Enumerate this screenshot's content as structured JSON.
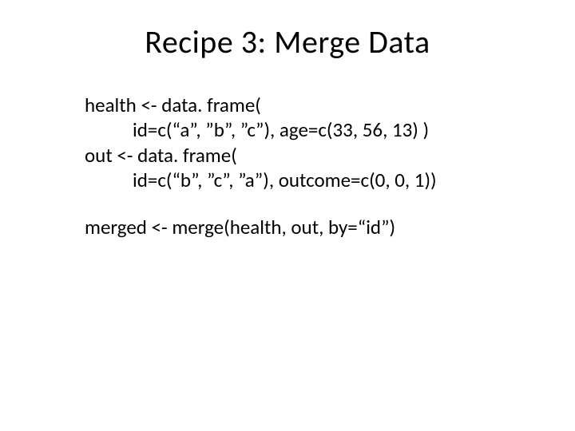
{
  "title": "Recipe 3: Merge Data",
  "code": {
    "l1": "health <- data. frame(",
    "l2": "id=c(“a”, ”b”, ”c”), age=c(33, 56, 13) )",
    "l3": "out <- data. frame(",
    "l4": "id=c(“b”, ”c”, ”a”), outcome=c(0, 0, 1))",
    "l5": "merged <- merge(health, out, by=“id”)"
  }
}
